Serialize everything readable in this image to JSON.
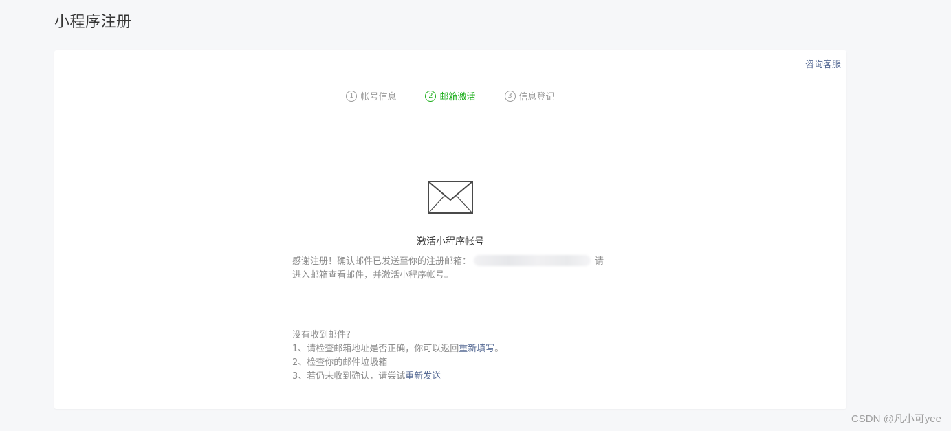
{
  "page": {
    "title": "小程序注册"
  },
  "header": {
    "help_link": "咨询客服"
  },
  "steps": [
    {
      "num": "1",
      "label": "帐号信息",
      "active": false
    },
    {
      "num": "2",
      "label": "邮箱激活",
      "active": true
    },
    {
      "num": "3",
      "label": "信息登记",
      "active": false
    }
  ],
  "main": {
    "icon": "mail-icon",
    "heading": "激活小程序帐号",
    "desc_part1": "感谢注册！确认邮件已发送至你的注册邮箱：",
    "desc_part2": "请进入邮箱查看邮件，并激活小程序帐号。"
  },
  "tips": {
    "title": "没有收到邮件?",
    "line1_text": "1、请检查邮箱地址是否正确，你可以返回",
    "line1_link": "重新填写",
    "line1_end": "。",
    "line2_text": "2、检查你的邮件垃圾箱",
    "line3_text": "3、若仍未收到确认，请尝试",
    "line3_link": "重新发送"
  },
  "watermark": "CSDN @凡小可yee",
  "colors": {
    "accent_green": "#1aad19",
    "link_blue": "#576b95",
    "background": "#f6f7f9"
  }
}
